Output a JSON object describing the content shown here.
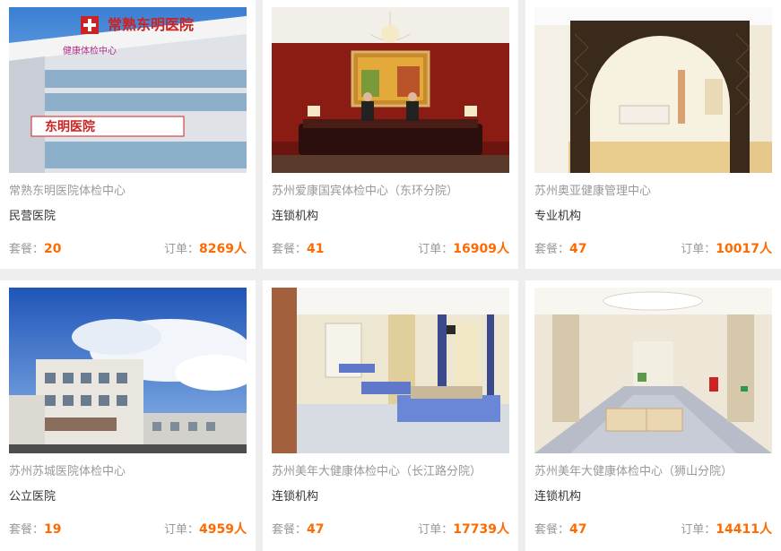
{
  "labels": {
    "package_prefix": "套餐：",
    "orders_prefix": "订单：",
    "orders_suffix": "人"
  },
  "cards": [
    {
      "name": "常熟东明医院体检中心",
      "type": "民营医院",
      "packages": "20",
      "orders": "8269",
      "photo": {
        "sign": "常熟东明医院",
        "sub": "东明医院",
        "banner": "健康体检中心"
      }
    },
    {
      "name": "苏州爱康国宾体检中心（东环分院）",
      "type": "连锁机构",
      "packages": "41",
      "orders": "16909"
    },
    {
      "name": "苏州奥亚健康管理中心",
      "type": "专业机构",
      "packages": "47",
      "orders": "10017"
    },
    {
      "name": "苏州苏城医院体检中心",
      "type": "公立医院",
      "packages": "19",
      "orders": "4959"
    },
    {
      "name": "苏州美年大健康体检中心（长江路分院）",
      "type": "连锁机构",
      "packages": "47",
      "orders": "17739"
    },
    {
      "name": "苏州美年大健康体检中心（狮山分院）",
      "type": "连锁机构",
      "packages": "47",
      "orders": "14411"
    }
  ],
  "colors": {
    "accent": "#ff6a00",
    "muted": "#999999",
    "text": "#333333",
    "page_bg": "#eeeeee"
  }
}
